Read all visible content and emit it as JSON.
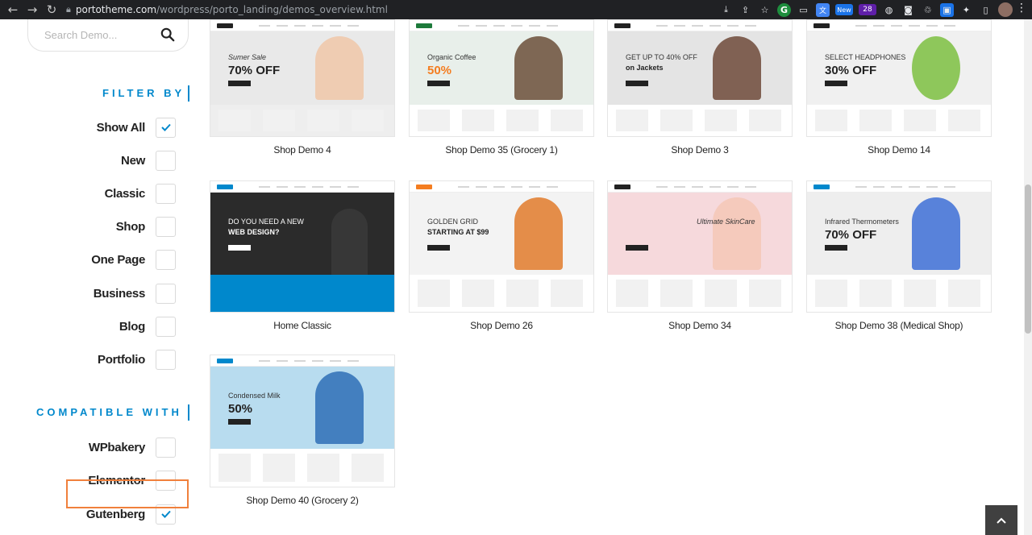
{
  "browser": {
    "url_host": "portotheme.com",
    "url_path": "/wordpress/porto_landing/demos_overview.html",
    "ext_new_label": "New",
    "ext_badge_count": "28",
    "grammarly_label": "G"
  },
  "sidebar": {
    "search_placeholder": "Search Demo...",
    "filter_heading": "FILTER BY",
    "filters": [
      {
        "label": "Show All",
        "checked": true
      },
      {
        "label": "New",
        "checked": false
      },
      {
        "label": "Classic",
        "checked": false
      },
      {
        "label": "Shop",
        "checked": false
      },
      {
        "label": "One Page",
        "checked": false
      },
      {
        "label": "Business",
        "checked": false
      },
      {
        "label": "Blog",
        "checked": false
      },
      {
        "label": "Portfolio",
        "checked": false
      }
    ],
    "compatible_heading": "COMPATIBLE WITH",
    "compatible": [
      {
        "label": "WPbakery",
        "checked": false
      },
      {
        "label": "Elementor",
        "checked": false
      },
      {
        "label": "Gutenberg",
        "checked": true
      }
    ]
  },
  "demos": [
    {
      "title": "Shop Demo 4",
      "headline": "Sumer Sale",
      "big": "70% OFF"
    },
    {
      "title": "Shop Demo 35 (Grocery 1)",
      "headline": "Organic Coffee",
      "big": "50%"
    },
    {
      "title": "Shop Demo 3",
      "headline": "GET UP TO 40% OFF",
      "big": "on Jackets"
    },
    {
      "title": "Shop Demo 14",
      "headline": "SELECT HEADPHONES",
      "big": "30% OFF"
    },
    {
      "title": "Home Classic",
      "headline": "DO YOU NEED A NEW",
      "big": "WEB DESIGN?"
    },
    {
      "title": "Shop Demo 26",
      "headline": "GOLDEN GRID",
      "big": "STARTING AT $99"
    },
    {
      "title": "Shop Demo 34",
      "headline": "Ultimate SkinCare",
      "big": ""
    },
    {
      "title": "Shop Demo 38 (Medical Shop)",
      "headline": "Infrared Thermometers",
      "big": "70% OFF"
    },
    {
      "title": "Shop Demo 40 (Grocery 2)",
      "headline": "Condensed Milk",
      "big": "50%"
    }
  ],
  "colors": {
    "accent": "#0088cc",
    "highlight": "#f0803c",
    "check": "#0088cc"
  }
}
